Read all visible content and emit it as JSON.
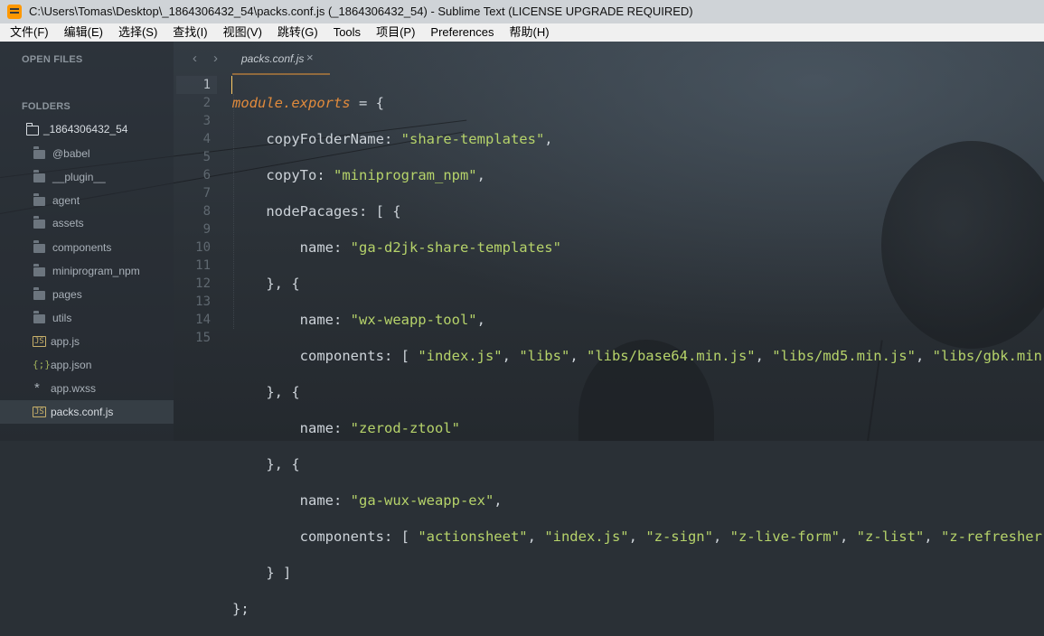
{
  "window": {
    "title": "C:\\Users\\Tomas\\Desktop\\_1864306432_54\\packs.conf.js (_1864306432_54) - Sublime Text (LICENSE UPGRADE REQUIRED)"
  },
  "menu": [
    "文件(F)",
    "编辑(E)",
    "选择(S)",
    "查找(I)",
    "视图(V)",
    "跳转(G)",
    "Tools",
    "项目(P)",
    "Preferences",
    "帮助(H)"
  ],
  "sidebar": {
    "open_files_label": "OPEN FILES",
    "folders_label": "FOLDERS",
    "root_folder": "_1864306432_54",
    "items": [
      {
        "label": "@babel",
        "type": "folder"
      },
      {
        "label": "__plugin__",
        "type": "folder"
      },
      {
        "label": "agent",
        "type": "folder"
      },
      {
        "label": "assets",
        "type": "folder"
      },
      {
        "label": "components",
        "type": "folder"
      },
      {
        "label": "miniprogram_npm",
        "type": "folder"
      },
      {
        "label": "pages",
        "type": "folder"
      },
      {
        "label": "utils",
        "type": "folder"
      },
      {
        "label": "app.js",
        "type": "js"
      },
      {
        "label": "app.json",
        "type": "json"
      },
      {
        "label": "app.wxss",
        "type": "css"
      },
      {
        "label": "packs.conf.js",
        "type": "js",
        "selected": true
      }
    ]
  },
  "tabs": [
    {
      "label": "packs.conf.js",
      "close": "×",
      "active": true
    }
  ],
  "nav": {
    "back": "‹",
    "forward": "›"
  },
  "editor": {
    "current_line": 1,
    "line_numbers": [
      "1",
      "2",
      "3",
      "4",
      "5",
      "6",
      "7",
      "8",
      "9",
      "10",
      "11",
      "12",
      "13",
      "14",
      "15"
    ],
    "code": {
      "l1_a": "module.exports",
      "l1_b": " = {",
      "l2_key": "copyFolderName",
      "l2_val": "\"share-templates\"",
      "l3_key": "copyTo",
      "l3_val": "\"miniprogram_npm\"",
      "l4_key": "nodePacages",
      "l4_rest": ": [ {",
      "l5_key": "name",
      "l5_val": "\"ga-d2jk-share-templates\"",
      "l6": "}, {",
      "l7_key": "name",
      "l7_val": "\"wx-weapp-tool\"",
      "l8_key": "components",
      "l8_v1": "\"index.js\"",
      "l8_v2": "\"libs\"",
      "l8_v3": "\"libs/base64.min.js\"",
      "l8_v4": "\"libs/md5.min.js\"",
      "l8_v5": "\"libs/gbk.min",
      "l9": "}, {",
      "l10_key": "name",
      "l10_val": "\"zerod-ztool\"",
      "l11": "}, {",
      "l12_key": "name",
      "l12_val": "\"ga-wux-weapp-ex\"",
      "l13_key": "components",
      "l13_v1": "\"actionsheet\"",
      "l13_v2": "\"index.js\"",
      "l13_v3": "\"z-sign\"",
      "l13_v4": "\"z-live-form\"",
      "l13_v5": "\"z-list\"",
      "l13_v6": "\"z-refresher",
      "l14": "} ]",
      "l15": "};"
    }
  }
}
